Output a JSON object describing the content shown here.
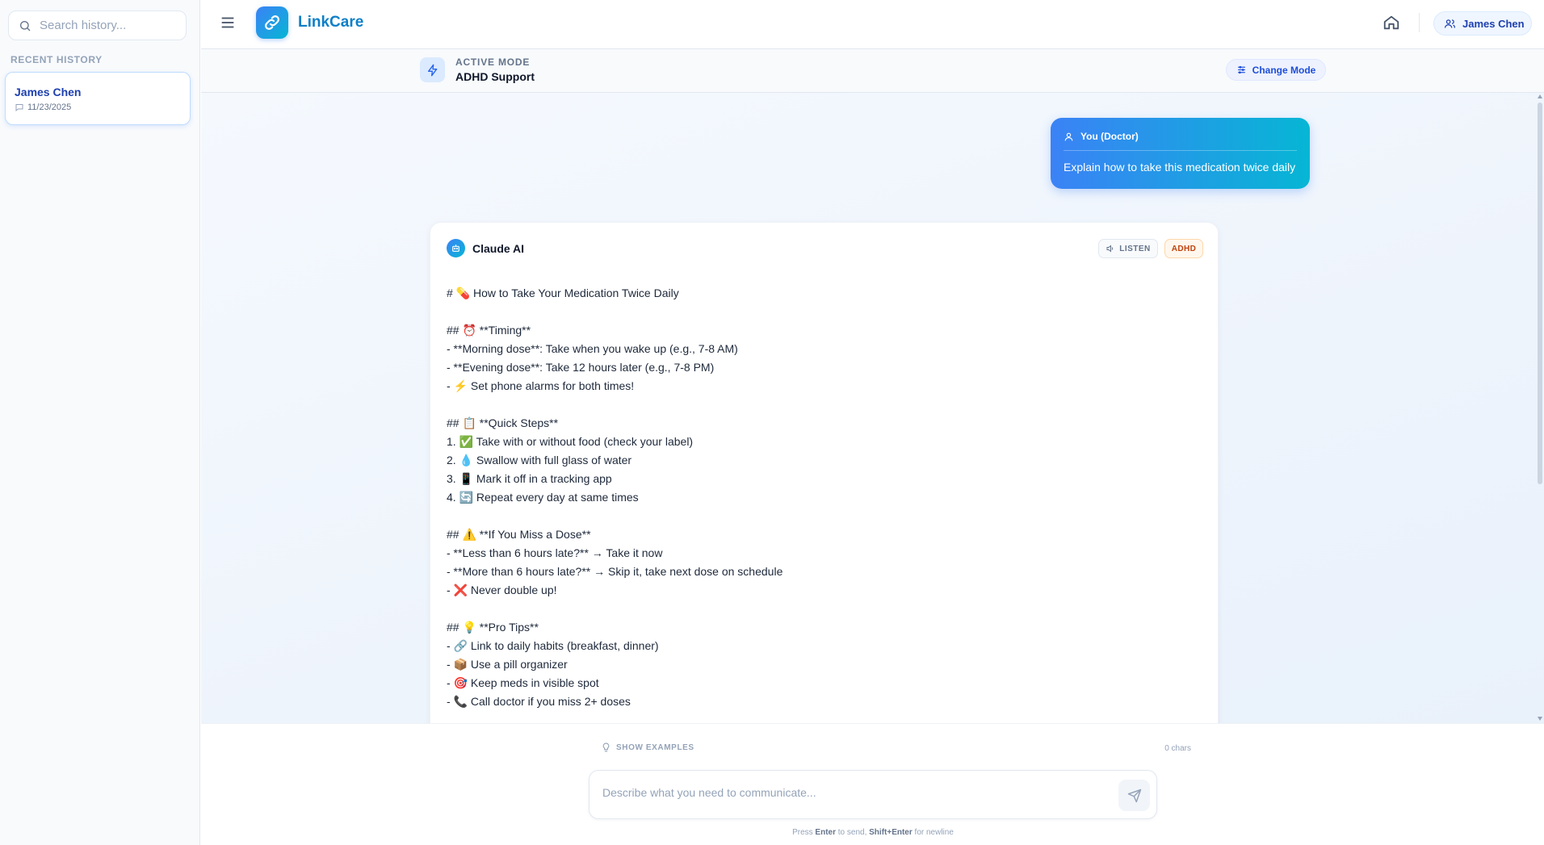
{
  "sidebar": {
    "search_placeholder": "Search history...",
    "recent_label": "RECENT HISTORY",
    "history": [
      {
        "name": "James Chen",
        "date": "11/23/2025"
      }
    ]
  },
  "topbar": {
    "brand": "LinkCare",
    "user_name": "James Chen"
  },
  "mode": {
    "label": "ACTIVE MODE",
    "value": "ADHD Support",
    "change_label": "Change Mode"
  },
  "conversation": {
    "doctor": {
      "sender": "You (Doctor)",
      "text": "Explain how to take this medication twice daily"
    },
    "ai": {
      "sender": "Claude AI",
      "listen_label": "LISTEN",
      "badge": "ADHD",
      "lines": [
        "# 💊 How to Take Your Medication Twice Daily",
        "",
        "## ⏰ **Timing**",
        "- **Morning dose**: Take when you wake up (e.g., 7-8 AM)",
        "- **Evening dose**: Take 12 hours later (e.g., 7-8 PM)",
        "- ⚡ Set phone alarms for both times!",
        "",
        "## 📋 **Quick Steps**",
        "1. ✅ Take with or without food (check your label)",
        "2. 💧 Swallow with full glass of water",
        "3. 📱 Mark it off in a tracking app",
        "4. 🔄 Repeat every day at same times",
        "",
        "## ⚠️ **If You Miss a Dose**",
        "- **Less than 6 hours late?** → Take it now",
        "- **More than 6 hours late?** → Skip it, take next dose on schedule",
        "- ❌ Never double up!",
        "",
        "## 💡 **Pro Tips**",
        "- 🔗 Link to daily habits (breakfast, dinner)",
        "- 📦 Use a pill organizer",
        "- 🎯 Keep meds in visible spot",
        "- 📞 Call doctor if you miss 2+ doses"
      ]
    }
  },
  "composer": {
    "examples_label": "SHOW EXAMPLES",
    "char_count": "0 chars",
    "placeholder": "Describe what you need to communicate...",
    "hint_press": "Press",
    "hint_enter": "Enter",
    "hint_send": "to send,",
    "hint_shift": "Shift+Enter",
    "hint_newline": "for newline"
  },
  "colors": {
    "accent": "#3b82f6",
    "accent_2": "#06b6d4",
    "badge": "#c2410c"
  },
  "icons": [
    "search-icon",
    "message-icon",
    "menu-icon",
    "link-icon",
    "home-icon",
    "users-icon",
    "bolt-icon",
    "sliders-icon",
    "user-icon",
    "bot-icon",
    "volume-icon",
    "lightbulb-icon",
    "send-icon"
  ]
}
